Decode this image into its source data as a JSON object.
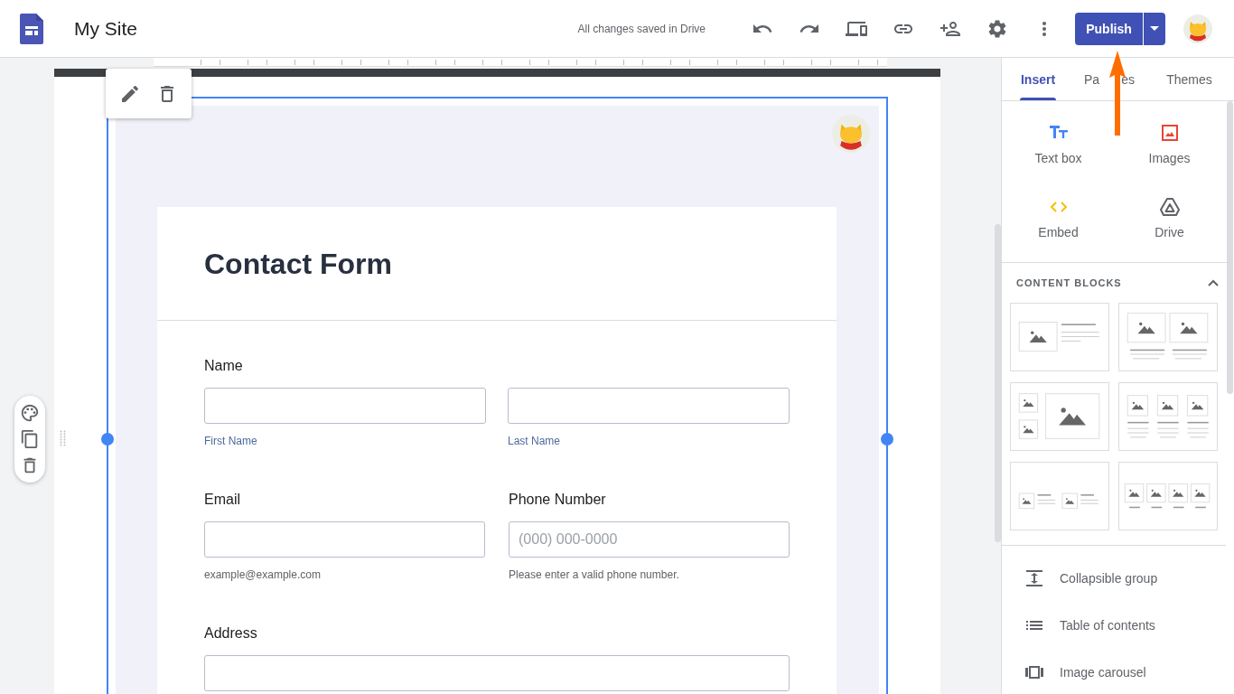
{
  "app": {
    "title": "My Site",
    "save_status": "All changes saved in Drive",
    "publish_label": "Publish"
  },
  "form": {
    "title": "Contact Form",
    "rows": [
      {
        "fields": [
          {
            "label": "Name",
            "inputs": [
              {
                "kind": "line",
                "sublabel": "First Name"
              },
              {
                "kind": "line",
                "sublabel": "Last Name"
              }
            ]
          }
        ]
      },
      {
        "fields": [
          {
            "label": "Email",
            "inputs": [
              {
                "kind": "line",
                "helper": "example@example.com"
              }
            ]
          },
          {
            "label": "Phone Number",
            "inputs": [
              {
                "kind": "line",
                "placeholder": "(000) 000-0000",
                "helper": "Please enter a valid phone number."
              }
            ]
          }
        ]
      },
      {
        "fields": [
          {
            "label": "Address",
            "inputs": [
              {
                "kind": "line"
              }
            ]
          }
        ]
      }
    ]
  },
  "side_panel": {
    "tabs": [
      {
        "label_parts": [
          "Insert"
        ],
        "selected": true
      },
      {
        "label_parts": [
          "Pa",
          "es"
        ],
        "selected": false
      },
      {
        "label_parts": [
          "Themes"
        ],
        "selected": false
      }
    ],
    "insert_items": [
      {
        "label": "Text box",
        "kind": "textbox"
      },
      {
        "label": "Images",
        "kind": "images"
      },
      {
        "label": "Embed",
        "kind": "embed"
      },
      {
        "label": "Drive",
        "kind": "drive"
      }
    ],
    "content_blocks": {
      "title": "CONTENT BLOCKS",
      "expanded": true,
      "layouts": [
        {
          "kind": "image-text"
        },
        {
          "kind": "two-images"
        },
        {
          "kind": "image-grid"
        },
        {
          "kind": "three-cards"
        },
        {
          "kind": "two-small"
        },
        {
          "kind": "four-cards"
        }
      ]
    },
    "components": [
      {
        "label": "Collapsible group",
        "kind": "collapsible"
      },
      {
        "label": "Table of contents",
        "kind": "toc"
      },
      {
        "label": "Image carousel",
        "kind": "carousel"
      }
    ]
  }
}
